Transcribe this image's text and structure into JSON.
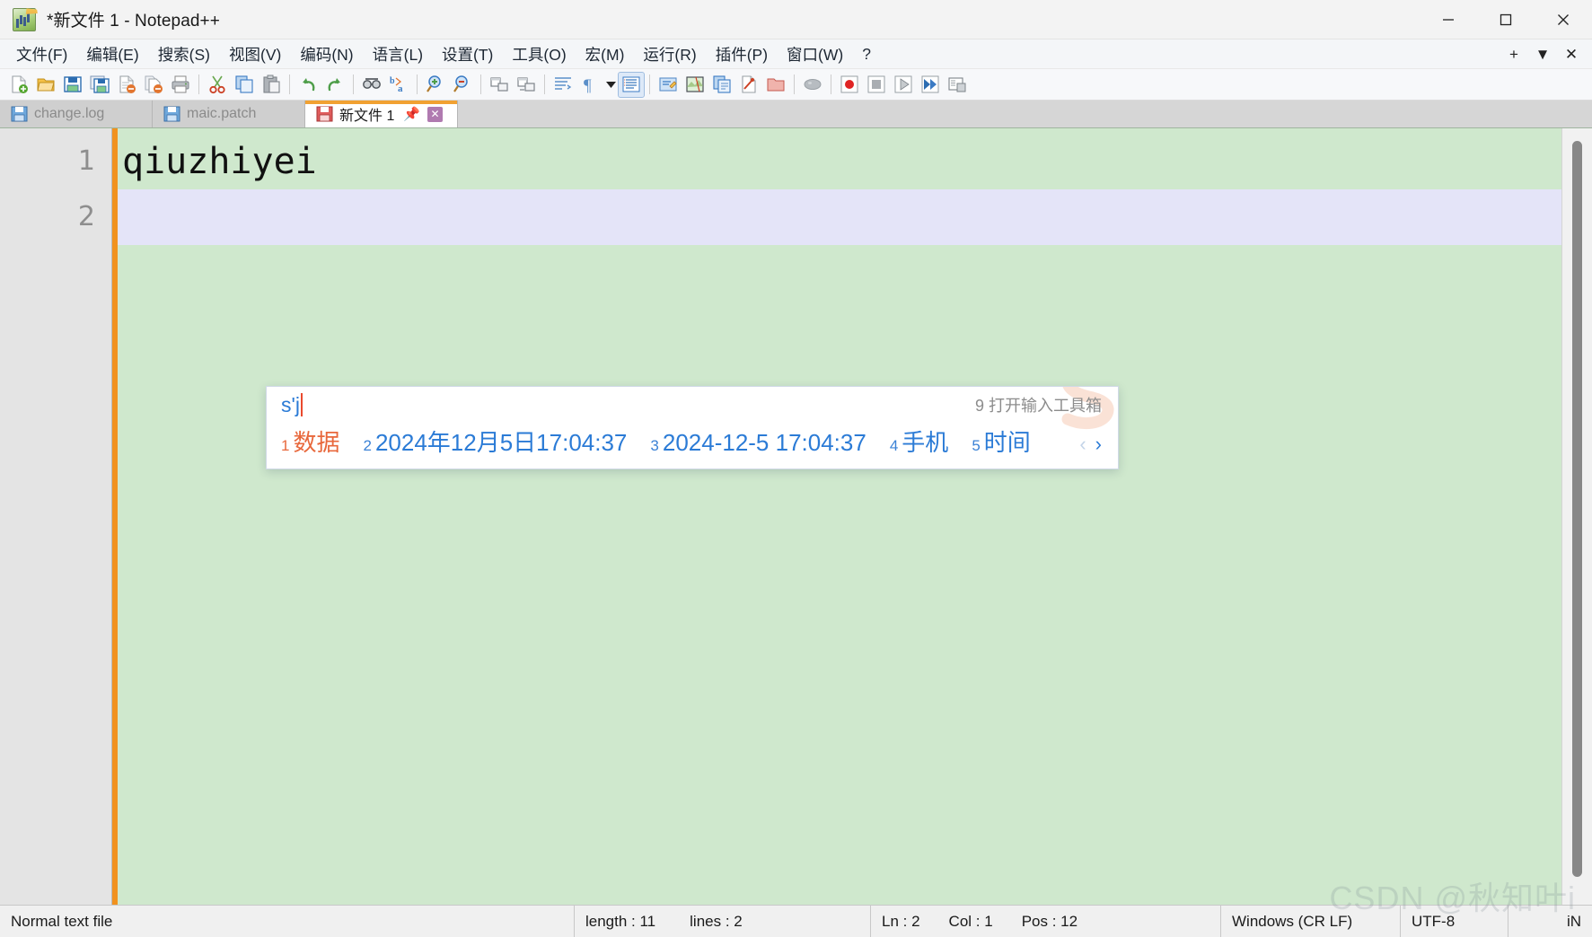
{
  "window": {
    "title": "*新文件 1 - Notepad++",
    "app_icon": "notepadpp-icon",
    "minimize": "—",
    "maximize": "□",
    "close": "✕"
  },
  "menubar": {
    "items": [
      {
        "label": "文件(F)",
        "name": "menu-file"
      },
      {
        "label": "编辑(E)",
        "name": "menu-edit"
      },
      {
        "label": "搜索(S)",
        "name": "menu-search"
      },
      {
        "label": "视图(V)",
        "name": "menu-view"
      },
      {
        "label": "编码(N)",
        "name": "menu-encoding"
      },
      {
        "label": "语言(L)",
        "name": "menu-language"
      },
      {
        "label": "设置(T)",
        "name": "menu-settings"
      },
      {
        "label": "工具(O)",
        "name": "menu-tools"
      },
      {
        "label": "宏(M)",
        "name": "menu-macro"
      },
      {
        "label": "运行(R)",
        "name": "menu-run"
      },
      {
        "label": "插件(P)",
        "name": "menu-plugins"
      },
      {
        "label": "窗口(W)",
        "name": "menu-window"
      },
      {
        "label": "?",
        "name": "menu-help"
      }
    ],
    "right_buttons": [
      {
        "label": "+",
        "name": "new-tab-button"
      },
      {
        "label": "▼",
        "name": "tab-list-button"
      },
      {
        "label": "✕",
        "name": "close-tab-button"
      }
    ]
  },
  "toolbar": {
    "items": [
      {
        "name": "new-file-icon",
        "title": "新建"
      },
      {
        "name": "open-file-icon",
        "title": "打开"
      },
      {
        "name": "save-icon",
        "title": "保存"
      },
      {
        "name": "save-all-icon",
        "title": "全部保存"
      },
      {
        "name": "close-file-icon",
        "title": "关闭"
      },
      {
        "name": "close-all-icon",
        "title": "全部关闭"
      },
      {
        "name": "print-icon",
        "title": "打印"
      },
      {
        "name": "cut-icon",
        "title": "剪切"
      },
      {
        "name": "copy-icon",
        "title": "复制"
      },
      {
        "name": "paste-icon",
        "title": "粘贴"
      },
      {
        "name": "undo-icon",
        "title": "撤销"
      },
      {
        "name": "redo-icon",
        "title": "重做"
      },
      {
        "name": "find-icon",
        "title": "查找"
      },
      {
        "name": "replace-icon",
        "title": "替换"
      },
      {
        "name": "zoom-in-icon",
        "title": "放大"
      },
      {
        "name": "zoom-out-icon",
        "title": "缩小"
      },
      {
        "name": "sync-vertical-icon",
        "title": "同步垂直滚动"
      },
      {
        "name": "sync-horizontal-icon",
        "title": "同步水平滚动"
      },
      {
        "name": "word-wrap-icon",
        "title": "自动换行"
      },
      {
        "name": "show-all-chars-icon",
        "title": "显示所有字符"
      },
      {
        "name": "indent-guide-icon",
        "title": "缩进参考线"
      },
      {
        "name": "user-define-dialog-icon",
        "title": "用户自定义语言"
      },
      {
        "name": "doc-map-icon",
        "title": "文档地图"
      },
      {
        "name": "function-list-icon",
        "title": "函数列表"
      },
      {
        "name": "doc-switcher-icon",
        "title": "文档列表"
      },
      {
        "name": "folder-workspace-icon",
        "title": "文件夹作为工作区"
      },
      {
        "name": "monitoring-icon",
        "title": "监视文件"
      },
      {
        "name": "record-macro-icon",
        "title": "录制宏"
      },
      {
        "name": "stop-macro-icon",
        "title": "停止录制"
      },
      {
        "name": "play-macro-icon",
        "title": "播放宏"
      },
      {
        "name": "run-macro-multiple-icon",
        "title": "多次运行宏"
      },
      {
        "name": "save-macro-icon",
        "title": "保存当前录制的宏"
      }
    ]
  },
  "tabs": [
    {
      "label": "change.log",
      "active": false,
      "icon": "saved-file-icon"
    },
    {
      "label": "maic.patch",
      "active": false,
      "icon": "saved-file-icon"
    },
    {
      "label": "新文件 1",
      "active": true,
      "icon": "unsaved-file-icon",
      "pin": "📌",
      "close": "✕"
    }
  ],
  "editor": {
    "line_numbers": [
      "1",
      "2"
    ],
    "lines": [
      "qiuzhiyei",
      ""
    ],
    "current_line_index": 1,
    "background": "#cfe8cd",
    "current_line_background": "#e4e4f8",
    "caret_margin_color": "#f1921e"
  },
  "ime": {
    "composition": "s'j",
    "hint": "9 打开输入工具箱",
    "candidates": [
      {
        "index": "1",
        "text": "数据"
      },
      {
        "index": "2",
        "text": "2024年12月5日17:04:37"
      },
      {
        "index": "3",
        "text": "2024-12-5 17:04:37"
      },
      {
        "index": "4",
        "text": "手机"
      },
      {
        "index": "5",
        "时间": "",
        "text": "时间"
      }
    ],
    "prev_arrow": "‹",
    "next_arrow": "›",
    "prev_enabled": false,
    "next_enabled": true,
    "highlight_color": "#e8683c",
    "normal_color": "#2b7bd6"
  },
  "statusbar": {
    "file_type": "Normal text file",
    "length_label": "length : 11",
    "lines_label": "lines : 2",
    "ln": "Ln : 2",
    "col": "Col : 1",
    "pos": "Pos : 12",
    "eol": "Windows (CR LF)",
    "encoding": "UTF-8",
    "insert_mode": "iN"
  },
  "watermark": "CSDN @秋知叶i"
}
